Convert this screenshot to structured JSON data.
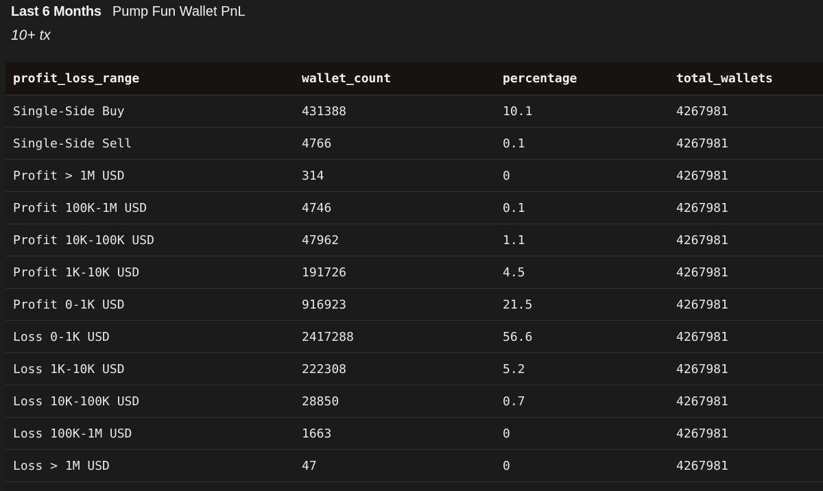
{
  "header": {
    "title": "Last 6 Months",
    "subtitle": "Pump Fun Wallet PnL",
    "subheading": "10+ tx"
  },
  "table": {
    "columns": [
      "profit_loss_range",
      "wallet_count",
      "percentage",
      "total_wallets"
    ],
    "rows": [
      [
        "Single-Side Buy",
        "431388",
        "10.1",
        "4267981"
      ],
      [
        "Single-Side Sell",
        "4766",
        "0.1",
        "4267981"
      ],
      [
        "Profit > 1M USD",
        "314",
        "0",
        "4267981"
      ],
      [
        "Profit 100K-1M USD",
        "4746",
        "0.1",
        "4267981"
      ],
      [
        "Profit 10K-100K USD",
        "47962",
        "1.1",
        "4267981"
      ],
      [
        "Profit 1K-10K USD",
        "191726",
        "4.5",
        "4267981"
      ],
      [
        "Profit 0-1K USD",
        "916923",
        "21.5",
        "4267981"
      ],
      [
        "Loss 0-1K USD",
        "2417288",
        "56.6",
        "4267981"
      ],
      [
        "Loss 1K-10K USD",
        "222308",
        "5.2",
        "4267981"
      ],
      [
        "Loss 10K-100K USD",
        "28850",
        "0.7",
        "4267981"
      ],
      [
        "Loss 100K-1M USD",
        "1663",
        "0",
        "4267981"
      ],
      [
        "Loss > 1M USD",
        "47",
        "0",
        "4267981"
      ]
    ]
  }
}
